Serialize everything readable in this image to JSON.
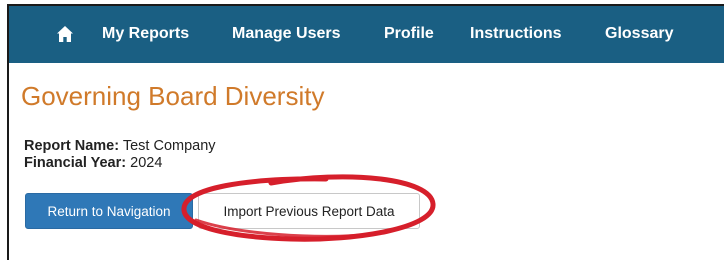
{
  "navbar": {
    "home_icon": "home-icon",
    "items": [
      {
        "label": "My Reports"
      },
      {
        "label": "Manage Users"
      },
      {
        "label": "Profile"
      },
      {
        "label": "Instructions"
      },
      {
        "label": "Glossary"
      }
    ]
  },
  "page": {
    "title": "Governing Board Diversity",
    "report_name_label": "Report Name:",
    "report_name_value": "Test Company",
    "financial_year_label": "Financial Year:",
    "financial_year_value": "2024"
  },
  "buttons": {
    "return_label": "Return to Navigation",
    "import_label": "Import Previous Report Data"
  },
  "colors": {
    "navbar_bg": "#1a5f83",
    "title_orange": "#d07a2a",
    "primary_button": "#2f78b7",
    "annotation_red": "#d61f2b"
  }
}
